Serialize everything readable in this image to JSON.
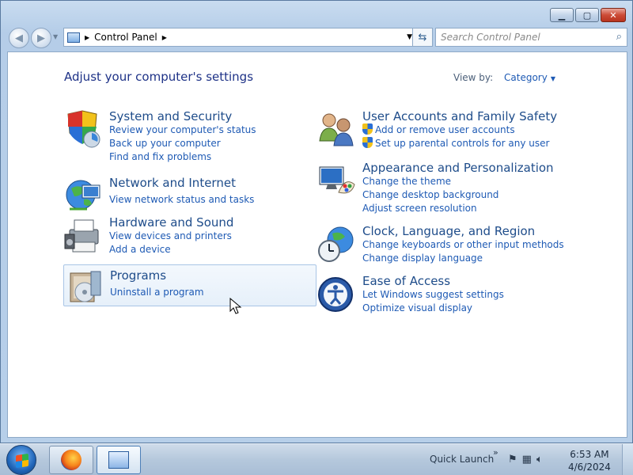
{
  "window": {
    "caption_buttons": {
      "minimize": "▁",
      "maximize": "▢",
      "close": "✕"
    }
  },
  "navbar": {
    "address_path": "Control Panel",
    "search_placeholder": "Search Control Panel",
    "refresh_icon": "⇆"
  },
  "content": {
    "heading": "Adjust your computer's settings",
    "view_by_label": "View by:",
    "view_by_value": "Category"
  },
  "categories": [
    {
      "title": "System and Security",
      "links": [
        "Review your computer's status",
        "Back up your computer",
        "Find and fix problems"
      ]
    },
    {
      "title": "Network and Internet",
      "links": [
        "View network status and tasks"
      ]
    },
    {
      "title": "Hardware and Sound",
      "links": [
        "View devices and printers",
        "Add a device"
      ]
    },
    {
      "title": "Programs",
      "links": [
        "Uninstall a program"
      ]
    },
    {
      "title": "User Accounts and Family Safety",
      "links": [
        "Add or remove user accounts",
        "Set up parental controls for any user"
      ]
    },
    {
      "title": "Appearance and Personalization",
      "links": [
        "Change the theme",
        "Change desktop background",
        "Adjust screen resolution"
      ]
    },
    {
      "title": "Clock, Language, and Region",
      "links": [
        "Change keyboards or other input methods",
        "Change display language"
      ]
    },
    {
      "title": "Ease of Access",
      "links": [
        "Let Windows suggest settings",
        "Optimize visual display"
      ]
    }
  ],
  "taskbar": {
    "quick_launch": "Quick Launch",
    "chevron": "»",
    "time": "6:53 AM",
    "date": "4/6/2024"
  }
}
